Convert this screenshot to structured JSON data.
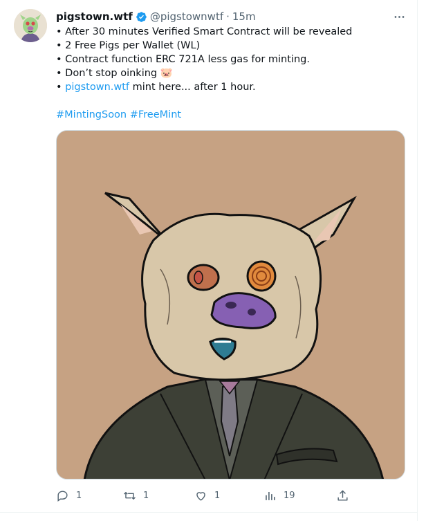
{
  "tweet": {
    "display_name": "pigstown.wtf",
    "handle": "@pigstownwtf",
    "separator": "·",
    "time": "15m",
    "lines": [
      "• After 30 minutes Verified Smart Contract will be revealed",
      "• 2 Free Pigs per Wallet (WL)",
      "• Contract function ERC 721A less gas for minting.",
      "• Don’t stop oinking 🐷"
    ],
    "last_line_bullet": "• ",
    "last_line_link": "pigstown.wtf",
    "last_line_rest": " mint here... after 1 hour.",
    "hashtags": [
      "#MintingSoon",
      "#FreeMint"
    ],
    "icons": {
      "more": "more-icon",
      "verified": "verified-badge-icon",
      "reply": "reply-icon",
      "retweet": "retweet-icon",
      "like": "like-icon",
      "views": "views-icon",
      "share": "share-icon"
    },
    "actions": {
      "reply_count": "1",
      "retweet_count": "1",
      "like_count": "1",
      "views_count": "19"
    }
  },
  "colors": {
    "link": "#1d9bf0",
    "muted": "#536471",
    "media_bg": "#c6a283"
  }
}
